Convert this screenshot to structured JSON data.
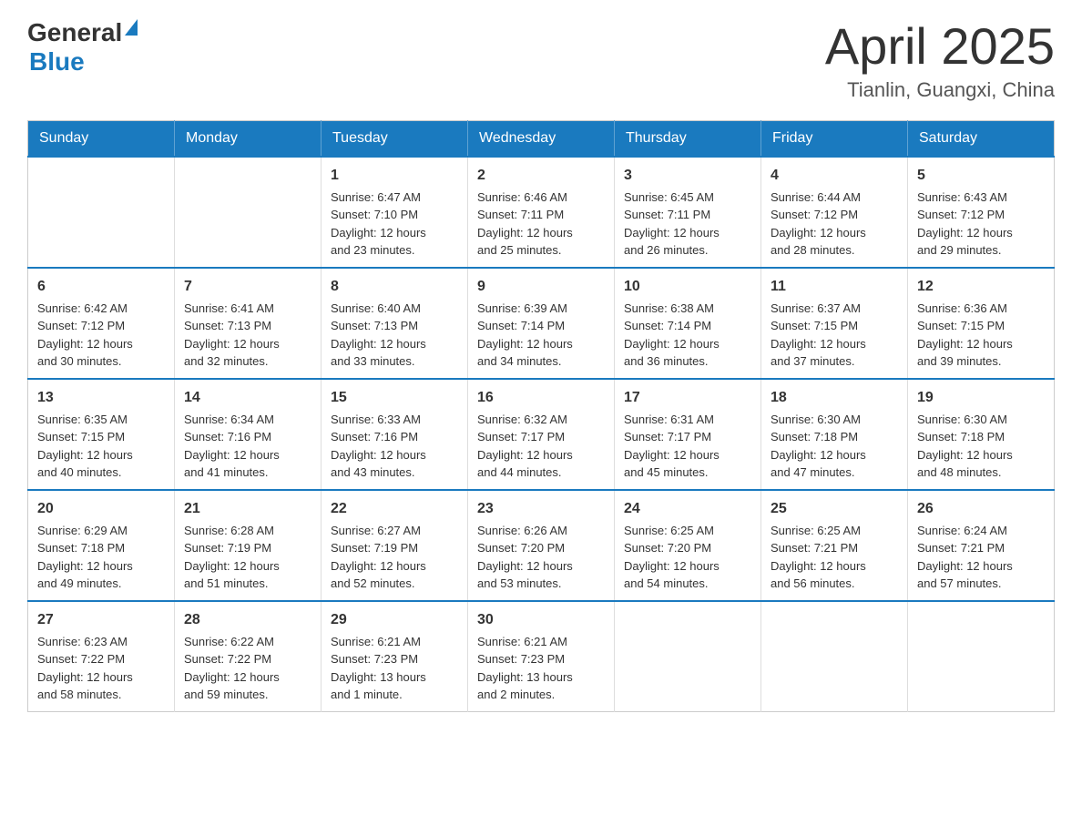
{
  "header": {
    "logo": {
      "general": "General",
      "blue": "Blue"
    },
    "title": "April 2025",
    "location": "Tianlin, Guangxi, China"
  },
  "calendar": {
    "days_of_week": [
      "Sunday",
      "Monday",
      "Tuesday",
      "Wednesday",
      "Thursday",
      "Friday",
      "Saturday"
    ],
    "weeks": [
      [
        {
          "day": "",
          "info": ""
        },
        {
          "day": "",
          "info": ""
        },
        {
          "day": "1",
          "info": "Sunrise: 6:47 AM\nSunset: 7:10 PM\nDaylight: 12 hours\nand 23 minutes."
        },
        {
          "day": "2",
          "info": "Sunrise: 6:46 AM\nSunset: 7:11 PM\nDaylight: 12 hours\nand 25 minutes."
        },
        {
          "day": "3",
          "info": "Sunrise: 6:45 AM\nSunset: 7:11 PM\nDaylight: 12 hours\nand 26 minutes."
        },
        {
          "day": "4",
          "info": "Sunrise: 6:44 AM\nSunset: 7:12 PM\nDaylight: 12 hours\nand 28 minutes."
        },
        {
          "day": "5",
          "info": "Sunrise: 6:43 AM\nSunset: 7:12 PM\nDaylight: 12 hours\nand 29 minutes."
        }
      ],
      [
        {
          "day": "6",
          "info": "Sunrise: 6:42 AM\nSunset: 7:12 PM\nDaylight: 12 hours\nand 30 minutes."
        },
        {
          "day": "7",
          "info": "Sunrise: 6:41 AM\nSunset: 7:13 PM\nDaylight: 12 hours\nand 32 minutes."
        },
        {
          "day": "8",
          "info": "Sunrise: 6:40 AM\nSunset: 7:13 PM\nDaylight: 12 hours\nand 33 minutes."
        },
        {
          "day": "9",
          "info": "Sunrise: 6:39 AM\nSunset: 7:14 PM\nDaylight: 12 hours\nand 34 minutes."
        },
        {
          "day": "10",
          "info": "Sunrise: 6:38 AM\nSunset: 7:14 PM\nDaylight: 12 hours\nand 36 minutes."
        },
        {
          "day": "11",
          "info": "Sunrise: 6:37 AM\nSunset: 7:15 PM\nDaylight: 12 hours\nand 37 minutes."
        },
        {
          "day": "12",
          "info": "Sunrise: 6:36 AM\nSunset: 7:15 PM\nDaylight: 12 hours\nand 39 minutes."
        }
      ],
      [
        {
          "day": "13",
          "info": "Sunrise: 6:35 AM\nSunset: 7:15 PM\nDaylight: 12 hours\nand 40 minutes."
        },
        {
          "day": "14",
          "info": "Sunrise: 6:34 AM\nSunset: 7:16 PM\nDaylight: 12 hours\nand 41 minutes."
        },
        {
          "day": "15",
          "info": "Sunrise: 6:33 AM\nSunset: 7:16 PM\nDaylight: 12 hours\nand 43 minutes."
        },
        {
          "day": "16",
          "info": "Sunrise: 6:32 AM\nSunset: 7:17 PM\nDaylight: 12 hours\nand 44 minutes."
        },
        {
          "day": "17",
          "info": "Sunrise: 6:31 AM\nSunset: 7:17 PM\nDaylight: 12 hours\nand 45 minutes."
        },
        {
          "day": "18",
          "info": "Sunrise: 6:30 AM\nSunset: 7:18 PM\nDaylight: 12 hours\nand 47 minutes."
        },
        {
          "day": "19",
          "info": "Sunrise: 6:30 AM\nSunset: 7:18 PM\nDaylight: 12 hours\nand 48 minutes."
        }
      ],
      [
        {
          "day": "20",
          "info": "Sunrise: 6:29 AM\nSunset: 7:18 PM\nDaylight: 12 hours\nand 49 minutes."
        },
        {
          "day": "21",
          "info": "Sunrise: 6:28 AM\nSunset: 7:19 PM\nDaylight: 12 hours\nand 51 minutes."
        },
        {
          "day": "22",
          "info": "Sunrise: 6:27 AM\nSunset: 7:19 PM\nDaylight: 12 hours\nand 52 minutes."
        },
        {
          "day": "23",
          "info": "Sunrise: 6:26 AM\nSunset: 7:20 PM\nDaylight: 12 hours\nand 53 minutes."
        },
        {
          "day": "24",
          "info": "Sunrise: 6:25 AM\nSunset: 7:20 PM\nDaylight: 12 hours\nand 54 minutes."
        },
        {
          "day": "25",
          "info": "Sunrise: 6:25 AM\nSunset: 7:21 PM\nDaylight: 12 hours\nand 56 minutes."
        },
        {
          "day": "26",
          "info": "Sunrise: 6:24 AM\nSunset: 7:21 PM\nDaylight: 12 hours\nand 57 minutes."
        }
      ],
      [
        {
          "day": "27",
          "info": "Sunrise: 6:23 AM\nSunset: 7:22 PM\nDaylight: 12 hours\nand 58 minutes."
        },
        {
          "day": "28",
          "info": "Sunrise: 6:22 AM\nSunset: 7:22 PM\nDaylight: 12 hours\nand 59 minutes."
        },
        {
          "day": "29",
          "info": "Sunrise: 6:21 AM\nSunset: 7:23 PM\nDaylight: 13 hours\nand 1 minute."
        },
        {
          "day": "30",
          "info": "Sunrise: 6:21 AM\nSunset: 7:23 PM\nDaylight: 13 hours\nand 2 minutes."
        },
        {
          "day": "",
          "info": ""
        },
        {
          "day": "",
          "info": ""
        },
        {
          "day": "",
          "info": ""
        }
      ]
    ]
  }
}
